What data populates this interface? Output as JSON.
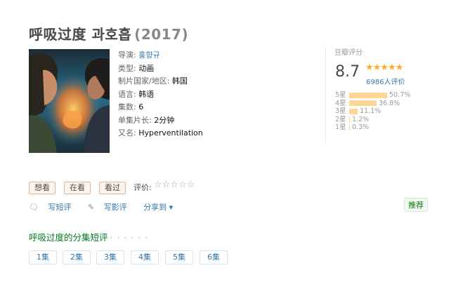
{
  "title": "呼吸过度 과호흡",
  "year": "(2017)",
  "info": [
    {
      "label": "导演:",
      "value": "홍향규",
      "link": true
    },
    {
      "label": "类型:",
      "value": "动画",
      "link": false
    },
    {
      "label": "制片国家/地区:",
      "value": "韩国",
      "link": false
    },
    {
      "label": "语言:",
      "value": "韩语",
      "link": false
    },
    {
      "label": "集数:",
      "value": "6",
      "link": false
    },
    {
      "label": "单集片长:",
      "value": "2分钟",
      "link": false
    },
    {
      "label": "又名:",
      "value": "Hyperventilation",
      "link": false
    }
  ],
  "rating": {
    "label": "豆瓣评分",
    "score": "8.7",
    "stars": "★★★★★",
    "people": "6986人评价",
    "breakdown": [
      {
        "star": "5星",
        "percent": 50.7,
        "text": "50.7%"
      },
      {
        "star": "4星",
        "percent": 36.8,
        "text": "36.8%"
      },
      {
        "star": "3星",
        "percent": 11.1,
        "text": "11.1%"
      },
      {
        "star": "2星",
        "percent": 1.2,
        "text": "1.2%"
      },
      {
        "star": "1星",
        "percent": 0.3,
        "text": "0.3%"
      }
    ]
  },
  "buttons": {
    "want": "想看",
    "doing": "在看",
    "done": "看过"
  },
  "rate_label": "评价:",
  "rate_stars": "☆☆☆☆☆",
  "actions": {
    "short_review": "写短评",
    "review": "写影评",
    "share": "分享到 ▾"
  },
  "recommend": "推荐",
  "section_title": "呼吸过度的分集短评",
  "section_dots": "· · · · · ·",
  "episodes": [
    "1集",
    "2集",
    "3集",
    "4集",
    "5集",
    "6集"
  ],
  "colors": {
    "star": "#ffac2d",
    "bar": "#ffd596",
    "link": "#3377aa",
    "green": "#007722"
  }
}
